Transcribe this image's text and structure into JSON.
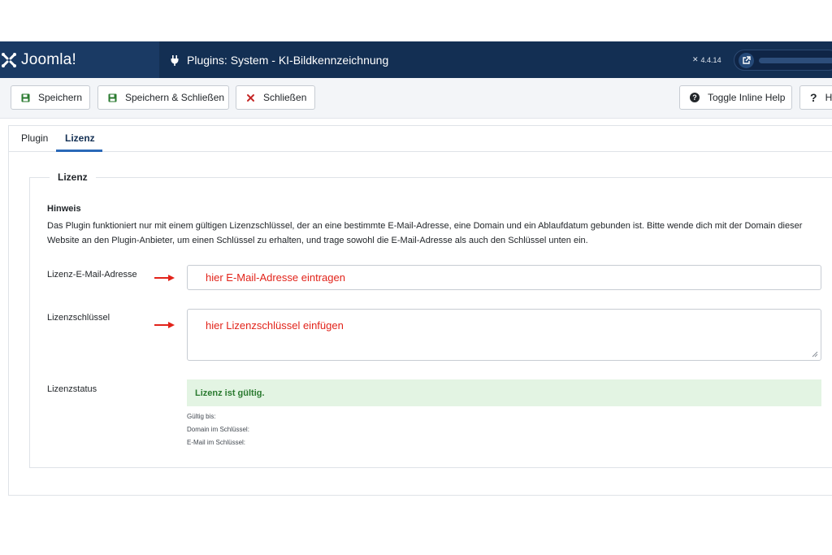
{
  "app": {
    "brand": "Joomla!",
    "page_title": "Plugins: System - KI-Bildkennzeichnung",
    "version": "4.4.14",
    "colors": {
      "header": "#132f53",
      "accent": "#2a69b8",
      "success_bg": "#e3f4e3",
      "success_text": "#2a7a2f",
      "annotation": "#e2231a"
    }
  },
  "toolbar": {
    "save_label": "Speichern",
    "save_close_label": "Speichern & Schließen",
    "close_label": "Schließen",
    "toggle_help_label": "Toggle Inline Help",
    "help_label": "H"
  },
  "tabs": [
    {
      "label": "Plugin",
      "active": false
    },
    {
      "label": "Lizenz",
      "active": true
    }
  ],
  "fieldset": {
    "legend": "Lizenz",
    "hint_title": "Hinweis",
    "hint_text": "Das Plugin funktioniert nur mit einem gültigen Lizenzschlüssel, der an eine bestimmte E-Mail-Adresse, eine Domain und ein Ablaufdatum gebunden ist. Bitte wende dich mit der Domain dieser Website an den Plugin-Anbieter, um einen Schlüssel zu erhalten, und trage sowohl die E-Mail-Adresse als auch den Schlüssel unten ein."
  },
  "fields": {
    "email_label": "Lizenz-E-Mail-Adresse",
    "email_value": "hier E-Mail-Adresse eintragen",
    "key_label": "Lizenzschlüssel",
    "key_value": "hier Lizenzschlüssel einfügen",
    "status_label": "Lizenzstatus",
    "status_message": "Lizenz ist gültig.",
    "valid_until_label": "Gültig bis:",
    "domain_label": "Domain im Schlüssel:",
    "email_in_key_label": "E-Mail im Schlüssel:"
  },
  "icons": [
    "joomla-logo-icon",
    "plug-icon",
    "external-link-icon",
    "save-icon",
    "save-close-icon",
    "close-icon",
    "question-circle-icon",
    "question-icon",
    "arrow-right-icon",
    "resize-grip-icon"
  ]
}
